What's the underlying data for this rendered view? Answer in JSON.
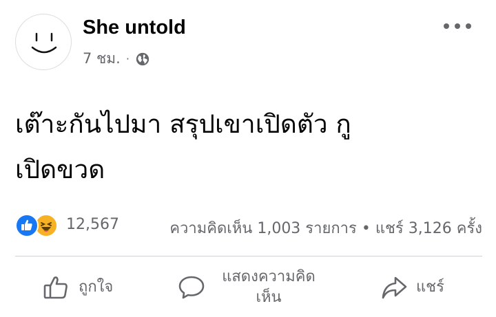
{
  "post": {
    "page_name": "She untold",
    "time": "7 ชม.",
    "separator": "·",
    "privacy_icon": "globe-icon",
    "text_line1": "เต๊าะกันไปมา สรุปเขาเปิดตัว กู",
    "text_line2": "เปิดขวด"
  },
  "stats": {
    "reaction_icons": [
      "like-icon",
      "haha-icon"
    ],
    "reaction_count": "12,567",
    "comments_shares": "ความคิดเห็น 1,003 รายการ • แชร์ 3,126 ครั้ง"
  },
  "actions": {
    "like_label": "ถูกใจ",
    "comment_label_line1": "แสดงความคิด",
    "comment_label_line2": "เห็น",
    "share_label": "แชร์"
  },
  "colors": {
    "text": "#050505",
    "secondary": "#65676b",
    "like_blue": "#1877f2",
    "haha_yellow": "#f7b125",
    "divider": "#ced0d4"
  }
}
